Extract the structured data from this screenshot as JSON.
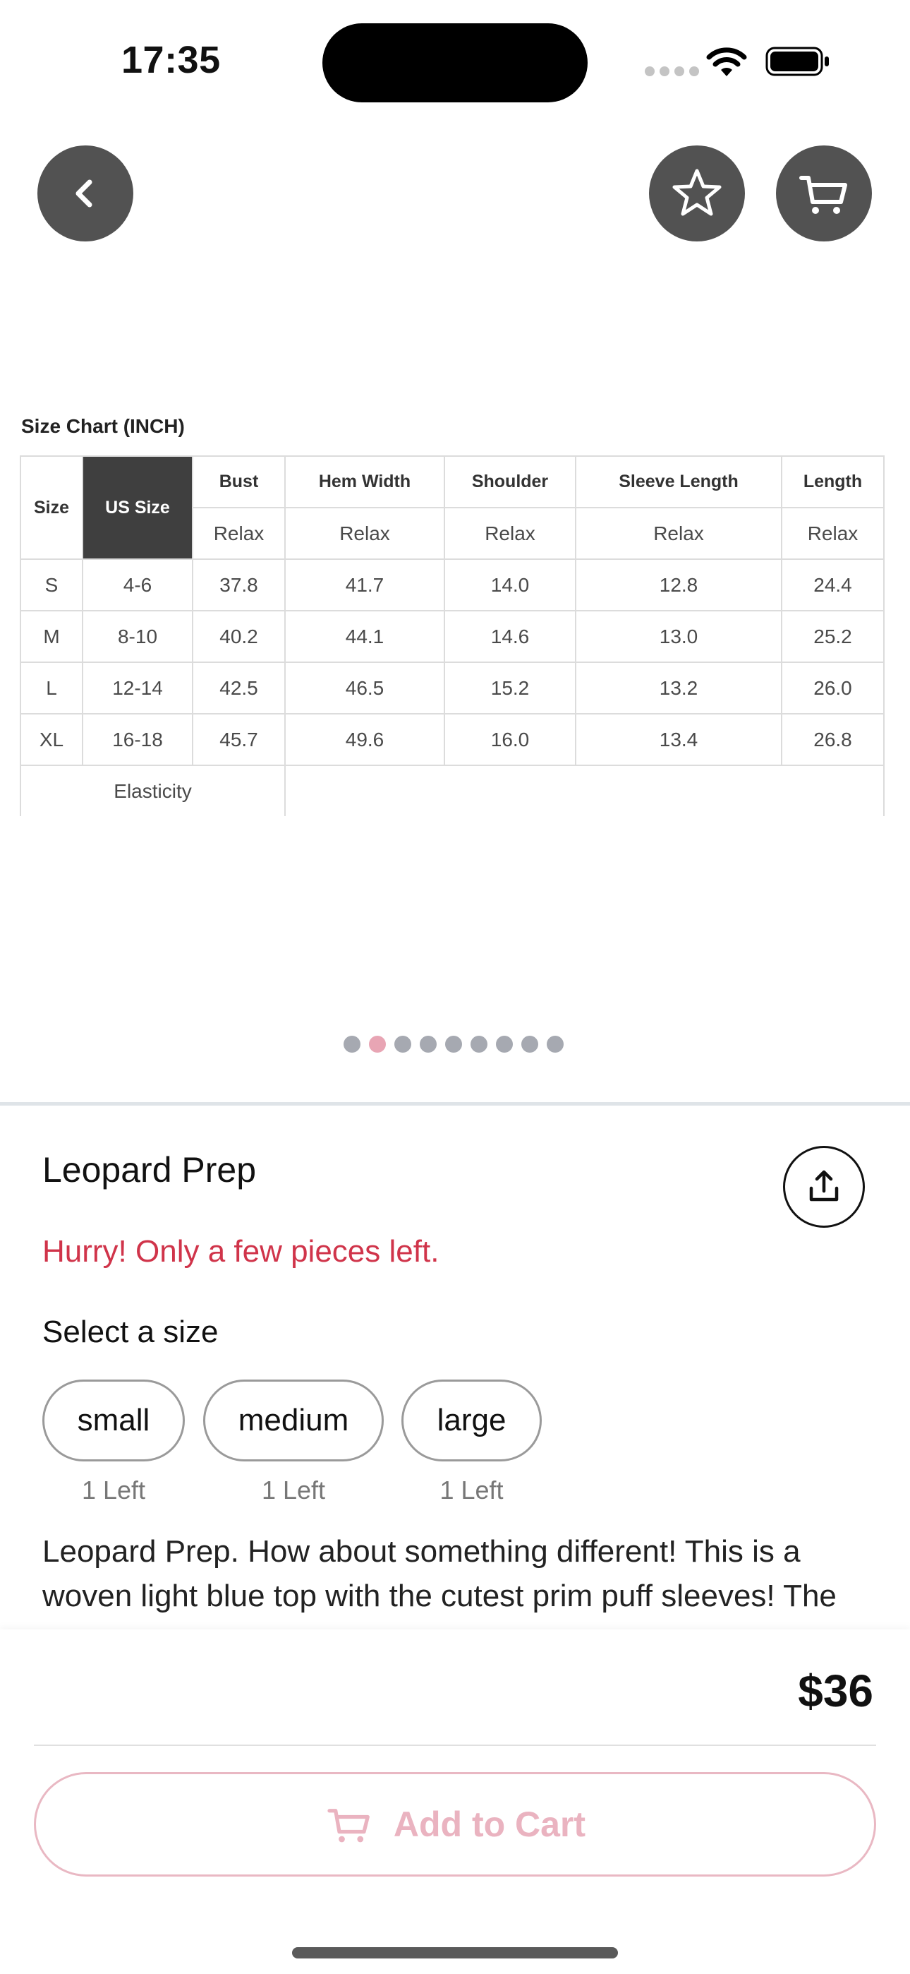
{
  "status_bar": {
    "time": "17:35"
  },
  "header": {
    "back_icon": "chevron-left-icon",
    "favorite_icon": "star-icon",
    "cart_icon": "cart-icon"
  },
  "size_chart": {
    "title": "Size Chart (INCH)",
    "columns": [
      "Size",
      "US Size",
      "Bust",
      "Hem Width",
      "Shoulder",
      "Sleeve Length",
      "Length"
    ],
    "fit_row": [
      "Relax",
      "Relax",
      "Relax",
      "Relax",
      "Relax"
    ],
    "rows": [
      [
        "S",
        "4-6",
        "37.8",
        "41.7",
        "14.0",
        "12.8",
        "24.4"
      ],
      [
        "M",
        "8-10",
        "40.2",
        "44.1",
        "14.6",
        "13.0",
        "25.2"
      ],
      [
        "L",
        "12-14",
        "42.5",
        "46.5",
        "15.2",
        "13.2",
        "26.0"
      ],
      [
        "XL",
        "16-18",
        "45.7",
        "49.6",
        "16.0",
        "13.4",
        "26.8"
      ]
    ],
    "elasticity_label": "Elasticity"
  },
  "carousel": {
    "total": 9,
    "active_index": 1
  },
  "product": {
    "name": "Leopard Prep",
    "share_icon": "share-icon",
    "stock_warning": "Hurry! Only a few pieces left.",
    "select_size_label": "Select a size",
    "sizes": [
      {
        "label": "small",
        "stock": "1 Left"
      },
      {
        "label": "medium",
        "stock": "1 Left"
      },
      {
        "label": "large",
        "stock": "1 Left"
      }
    ],
    "description": "Leopard Prep. How about something different! This is a woven light blue top with the cutest prim puff sleeves! The"
  },
  "purchase": {
    "price": "$36",
    "add_to_cart_label": "Add to Cart",
    "add_to_cart_icon": "cart-icon"
  },
  "colors": {
    "accent_pink": "#eab3c0",
    "warning_red": "#d0344a",
    "button_gray": "#525252"
  }
}
